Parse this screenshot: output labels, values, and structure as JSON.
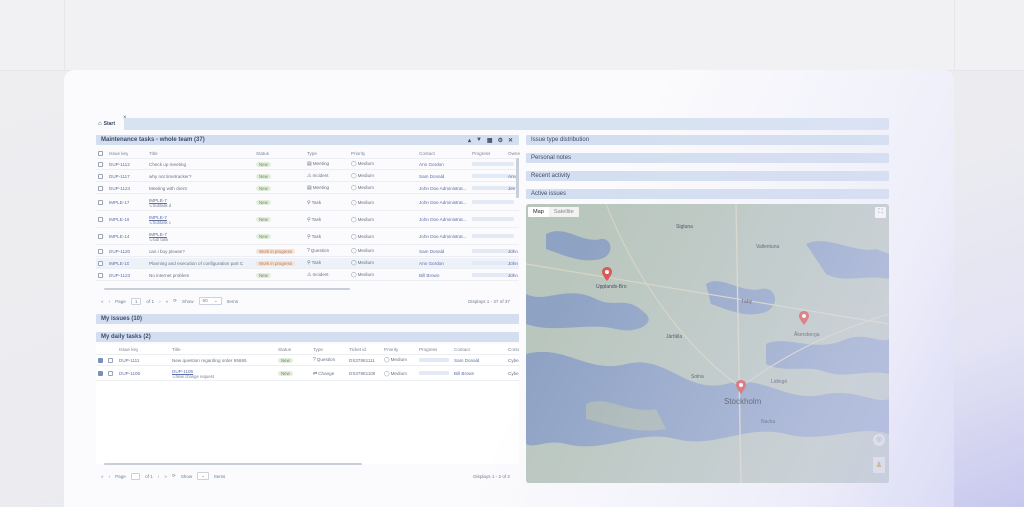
{
  "tabs": {
    "start_label": "Start",
    "close_glyph": "×"
  },
  "maintenance": {
    "title": "Maintenance tasks - whole team (37)",
    "columns": [
      "Issue key",
      "Title",
      "Status",
      "Type",
      "Priority",
      "Contact",
      "Progress",
      "Owner"
    ],
    "rows": [
      {
        "key": "DUP-1112",
        "title": "Check up meeting",
        "sub": "",
        "status": "New",
        "type": "Meeting",
        "priority": "Medium",
        "contact": "Ann Gordon",
        "owner": ""
      },
      {
        "key": "DUP-1117",
        "title": "why not timetracker?",
        "sub": "",
        "status": "New",
        "type": "Incident",
        "priority": "Medium",
        "contact": "Sam Donald",
        "owner": "Ann"
      },
      {
        "key": "DUP-1124",
        "title": "Meeting with client",
        "sub": "",
        "status": "New",
        "type": "Meeting",
        "priority": "Medium",
        "contact": "John Doe Administrat...",
        "owner": "Jem"
      },
      {
        "key": "IMPLE-17",
        "title": "IMPLE-7",
        "sub": "↳Subtask d",
        "status": "New",
        "type": "Task",
        "priority": "Medium",
        "contact": "John Doe Administrat...",
        "owner": ""
      },
      {
        "key": "IMPLE-16",
        "title": "IMPLE-7",
        "sub": "↳Subtask c",
        "status": "New",
        "type": "Task",
        "priority": "Medium",
        "contact": "John Doe Administrat...",
        "owner": ""
      },
      {
        "key": "IMPLE-14",
        "title": "IMPLE-7",
        "sub": "↳sub task",
        "status": "New",
        "type": "Task",
        "priority": "Medium",
        "contact": "John Doe Administrat...",
        "owner": ""
      },
      {
        "key": "DUP-1120",
        "title": "can i buy please?",
        "sub": "",
        "status": "Work in progress",
        "type": "Question",
        "priority": "Medium",
        "contact": "Sam Donald",
        "owner": "John"
      },
      {
        "key": "IMPLE-10",
        "title": "Planning and execution of configuration part C",
        "sub": "",
        "status": "Work in progress",
        "type": "Task",
        "priority": "Medium",
        "contact": "Ann Gordon",
        "owner": "John"
      },
      {
        "key": "DUP-1123",
        "title": "No internet problem",
        "sub": "",
        "status": "New",
        "type": "Incident",
        "priority": "Medium",
        "contact": "Bill Brown",
        "owner": "John"
      }
    ],
    "pager": {
      "page_label": "Page",
      "page_value": "1",
      "of_label": "of 1",
      "show_label": "Show",
      "show_value": "50",
      "items_label": "Items",
      "display_text": "Displays 1 - 37 of 37"
    }
  },
  "my_issues": {
    "title": "My issues (10)"
  },
  "daily": {
    "title": "My daily tasks (2)",
    "columns": [
      "Issue key",
      "Title",
      "Status",
      "Type",
      "Ticket id",
      "Priority",
      "Progress",
      "Contact",
      "Conta"
    ],
    "rows": [
      {
        "key": "DUP-1111",
        "title": "New question regarding order 65665",
        "sub": "",
        "status": "New",
        "type": "Question",
        "ticket": "DS37881111",
        "priority": "Medium",
        "contact": "Sam Donald",
        "extra": "Cyber"
      },
      {
        "key": "DUP-1106",
        "title": "DUP-1105",
        "sub": "↳New change request",
        "status": "New",
        "type": "Change",
        "ticket": "DS37881106",
        "priority": "Medium",
        "contact": "Bill Brown",
        "extra": "Cyber"
      }
    ],
    "pager": {
      "page_label": "Page",
      "of_label": "of 1",
      "show_label": "Show",
      "items_label": "Items",
      "display_text": "Displays 1 - 2 of 2"
    }
  },
  "right_panels": {
    "issue_type": "Issue type distribution",
    "personal_notes": "Personal notes",
    "recent_activity": "Recent activity",
    "active_issues": "Active issues"
  },
  "map": {
    "map_tab": "Map",
    "satellite_tab": "Satellite",
    "city": "Stockholm",
    "labels": [
      "Upplands-Bro",
      "Vallentuna",
      "Åkersberga",
      "Täby",
      "Lidingö",
      "Nacka",
      "Järfälla",
      "Sigtuna",
      "Solna"
    ],
    "pin_color": "#d9534f",
    "water_color": "#8ea2c4",
    "land_color": "#b9c6bd"
  },
  "colors": {
    "header_bg": "#d3dff0",
    "accent": "#5c6ea8"
  }
}
